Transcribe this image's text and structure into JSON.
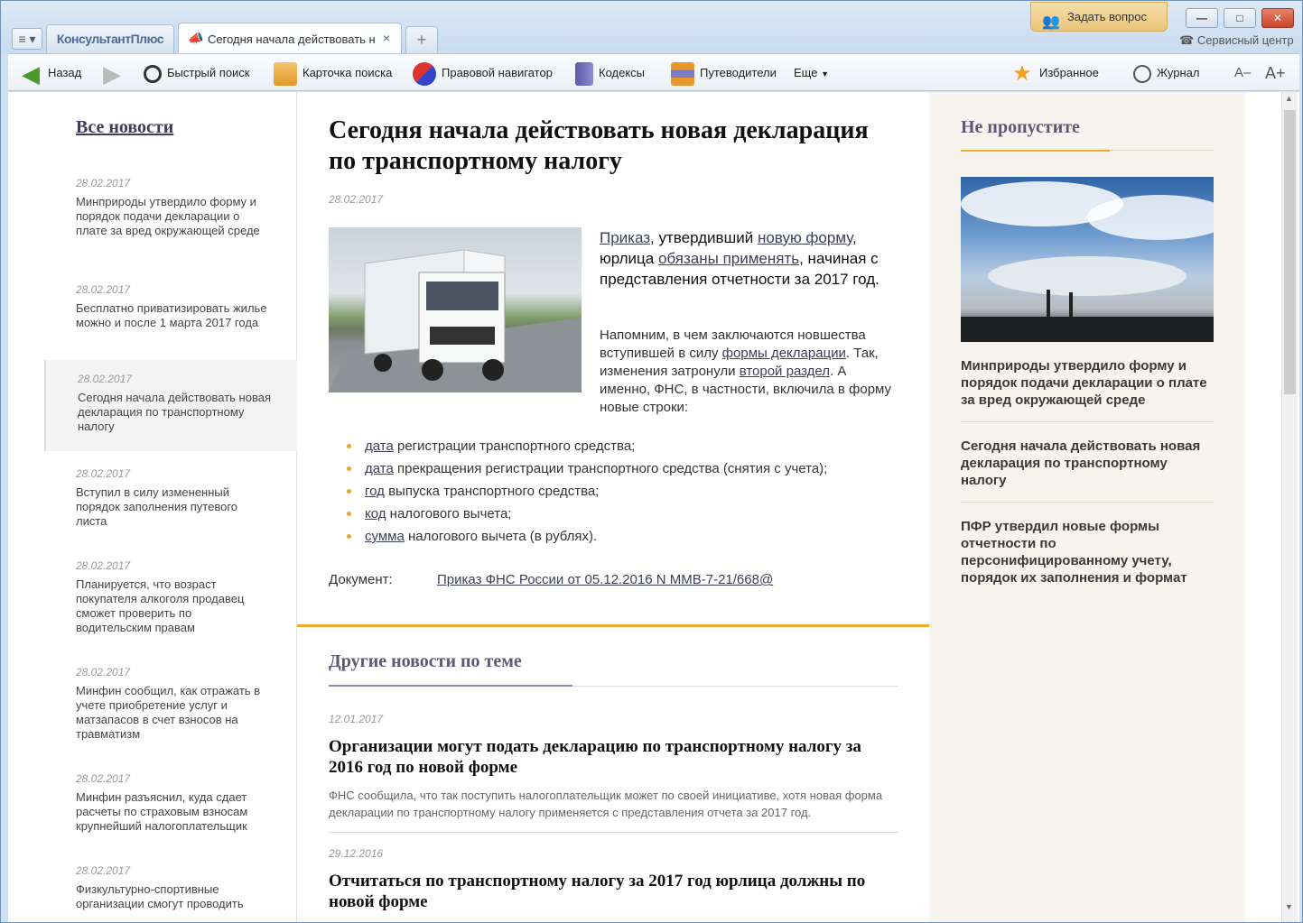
{
  "tabs": {
    "home": "КонсультантПлюс",
    "active": "Сегодня начала действовать н",
    "new": "+",
    "close": "×",
    "menu": "≡ ▾"
  },
  "header": {
    "ask": "Задать вопрос",
    "service": "Сервисный центр",
    "min": "—",
    "max": "□",
    "close": "✕"
  },
  "toolbar": {
    "back": "Назад",
    "quick_search": "Быстрый поиск",
    "search_card": "Карточка поиска",
    "navigator": "Правовой навигатор",
    "codes": "Кодексы",
    "guides": "Путеводители",
    "more": "Еще",
    "favorites": "Избранное",
    "journal": "Журнал",
    "font_minus": "A–",
    "font_plus": "A+"
  },
  "left": {
    "heading": "Все новости",
    "items": [
      {
        "date": "28.02.2017",
        "title": "Минприроды утвердило форму и порядок подачи декларации о плате за вред окружающей среде"
      },
      {
        "date": "28.02.2017",
        "title": "Бесплатно приватизировать жилье можно и после 1 марта 2017 года"
      },
      {
        "date": "28.02.2017",
        "title": "Сегодня начала действовать новая декларация по транспортному налогу"
      },
      {
        "date": "28.02.2017",
        "title": "Вступил в силу измененный порядок заполнения путевого листа"
      },
      {
        "date": "28.02.2017",
        "title": "Планируется, что возраст покупателя алкоголя продавец сможет проверить по водительским правам"
      },
      {
        "date": "28.02.2017",
        "title": "Минфин сообщил, как отражать в учете приобретение услуг и матзапасов в счет взносов на травматизм"
      },
      {
        "date": "28.02.2017",
        "title": "Минфин разъяснил, куда сдает расчеты по страховым взносам крупнейший налогоплательщик"
      },
      {
        "date": "28.02.2017",
        "title": "Физкультурно-спортивные организации смогут проводить"
      }
    ]
  },
  "article": {
    "title": "Сегодня начала действовать новая декларация по транспортному налогу",
    "date": "28.02.2017",
    "p1": {
      "l1": "Приказ",
      "t1": ", утвердивший ",
      "l2": "новую форму",
      "t2": ", юрлица ",
      "l3": "обязаны применять",
      "t3": ", начиная с представления отчетности за 2017 год."
    },
    "p2": {
      "t1": "Напомним, в чем заключаются новшества вступившей в силу ",
      "l1": "формы декларации",
      "t2": ". Так, изменения затронули ",
      "l2": "второй раздел",
      "t3": ". А именно, ФНС, в частности, включила в форму новые строки:"
    },
    "bullets": [
      {
        "link": "дата",
        "text": " регистрации транспортного средства;"
      },
      {
        "link": "дата",
        "text": " прекращения регистрации транспортного средства (снятия с учета);"
      },
      {
        "link": "год",
        "text": " выпуска транспортного средства;"
      },
      {
        "link": "код",
        "text": " налогового вычета;"
      },
      {
        "link": "сумма",
        "text": " налогового вычета (в рублях)."
      }
    ],
    "doc_label": "Документ:",
    "doc_link": "Приказ ФНС России от 05.12.2016 N ММВ-7-21/668@"
  },
  "other": {
    "heading": "Другие новости по теме",
    "items": [
      {
        "date": "12.01.2017",
        "title": "Организации могут подать декларацию по транспортному налогу за 2016 год по новой форме",
        "summary": "ФНС сообщила, что так поступить налогоплательщик может по своей инициативе, хотя новая форма декларации по транспортному налогу применяется с представления отчета за 2017 год."
      },
      {
        "date": "29.12.2016",
        "title": "Отчитаться по транспортному налогу за 2017 год юрлица должны по новой форме",
        "summary": ""
      }
    ]
  },
  "right": {
    "heading": "Не пропустите",
    "items": [
      "Минприроды утвердило форму и порядок подачи декларации о плате за вред окружающей среде",
      "Сегодня начала действовать новая декларация по транспортному налогу",
      "ПФР утвердил новые формы отчетности по персонифицированному учету, порядок их заполнения и формат"
    ]
  }
}
